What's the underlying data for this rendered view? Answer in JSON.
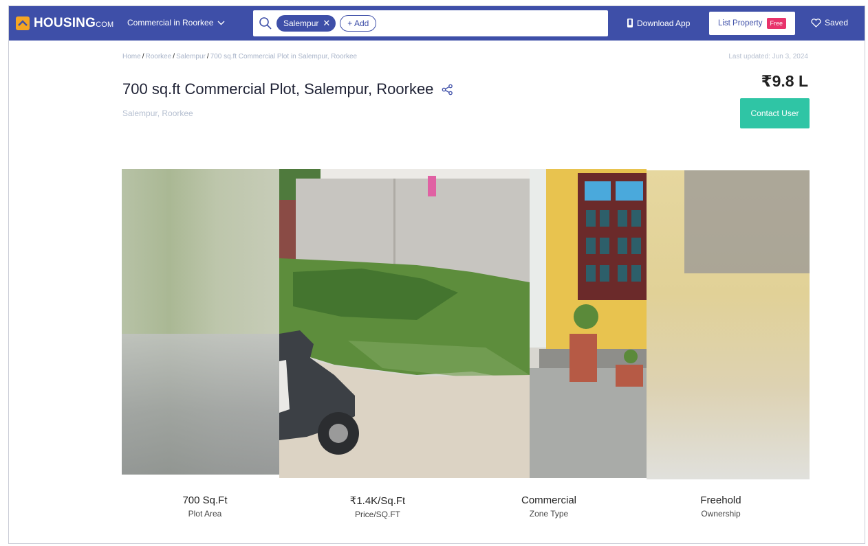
{
  "nav": {
    "logo_text": "HOUSING",
    "logo_suffix": "COM",
    "city_select": "Commercial in Roorkee",
    "search": {
      "chip": "Salempur",
      "add_label": "+ Add"
    },
    "download_app": "Download App",
    "list_property": "List Property",
    "free_badge": "Free",
    "saved": "Saved"
  },
  "breadcrumb": [
    "Home",
    "Roorkee",
    "Salempur",
    "700 sq.ft Commercial Plot in Salempur, Roorkee"
  ],
  "last_updated": "Last updated: Jun 3, 2024",
  "listing": {
    "title": "700 sq.ft Commercial Plot, Salempur, Roorkee",
    "sublocation": "Salempur, Roorkee",
    "price": "₹9.8 L",
    "contact_label": "Contact User"
  },
  "stats": [
    {
      "value": "700 Sq.Ft",
      "label": "Plot Area"
    },
    {
      "value": "₹1.4K/Sq.Ft",
      "label": "Price/SQ.FT"
    },
    {
      "value": "Commercial",
      "label": "Zone Type"
    },
    {
      "value": "Freehold",
      "label": "Ownership"
    }
  ],
  "colors": {
    "nav_bg": "#3e4fa8",
    "logo_accent": "#f5a623",
    "free_badge": "#e8336b",
    "contact_button": "#2fc5a5"
  }
}
